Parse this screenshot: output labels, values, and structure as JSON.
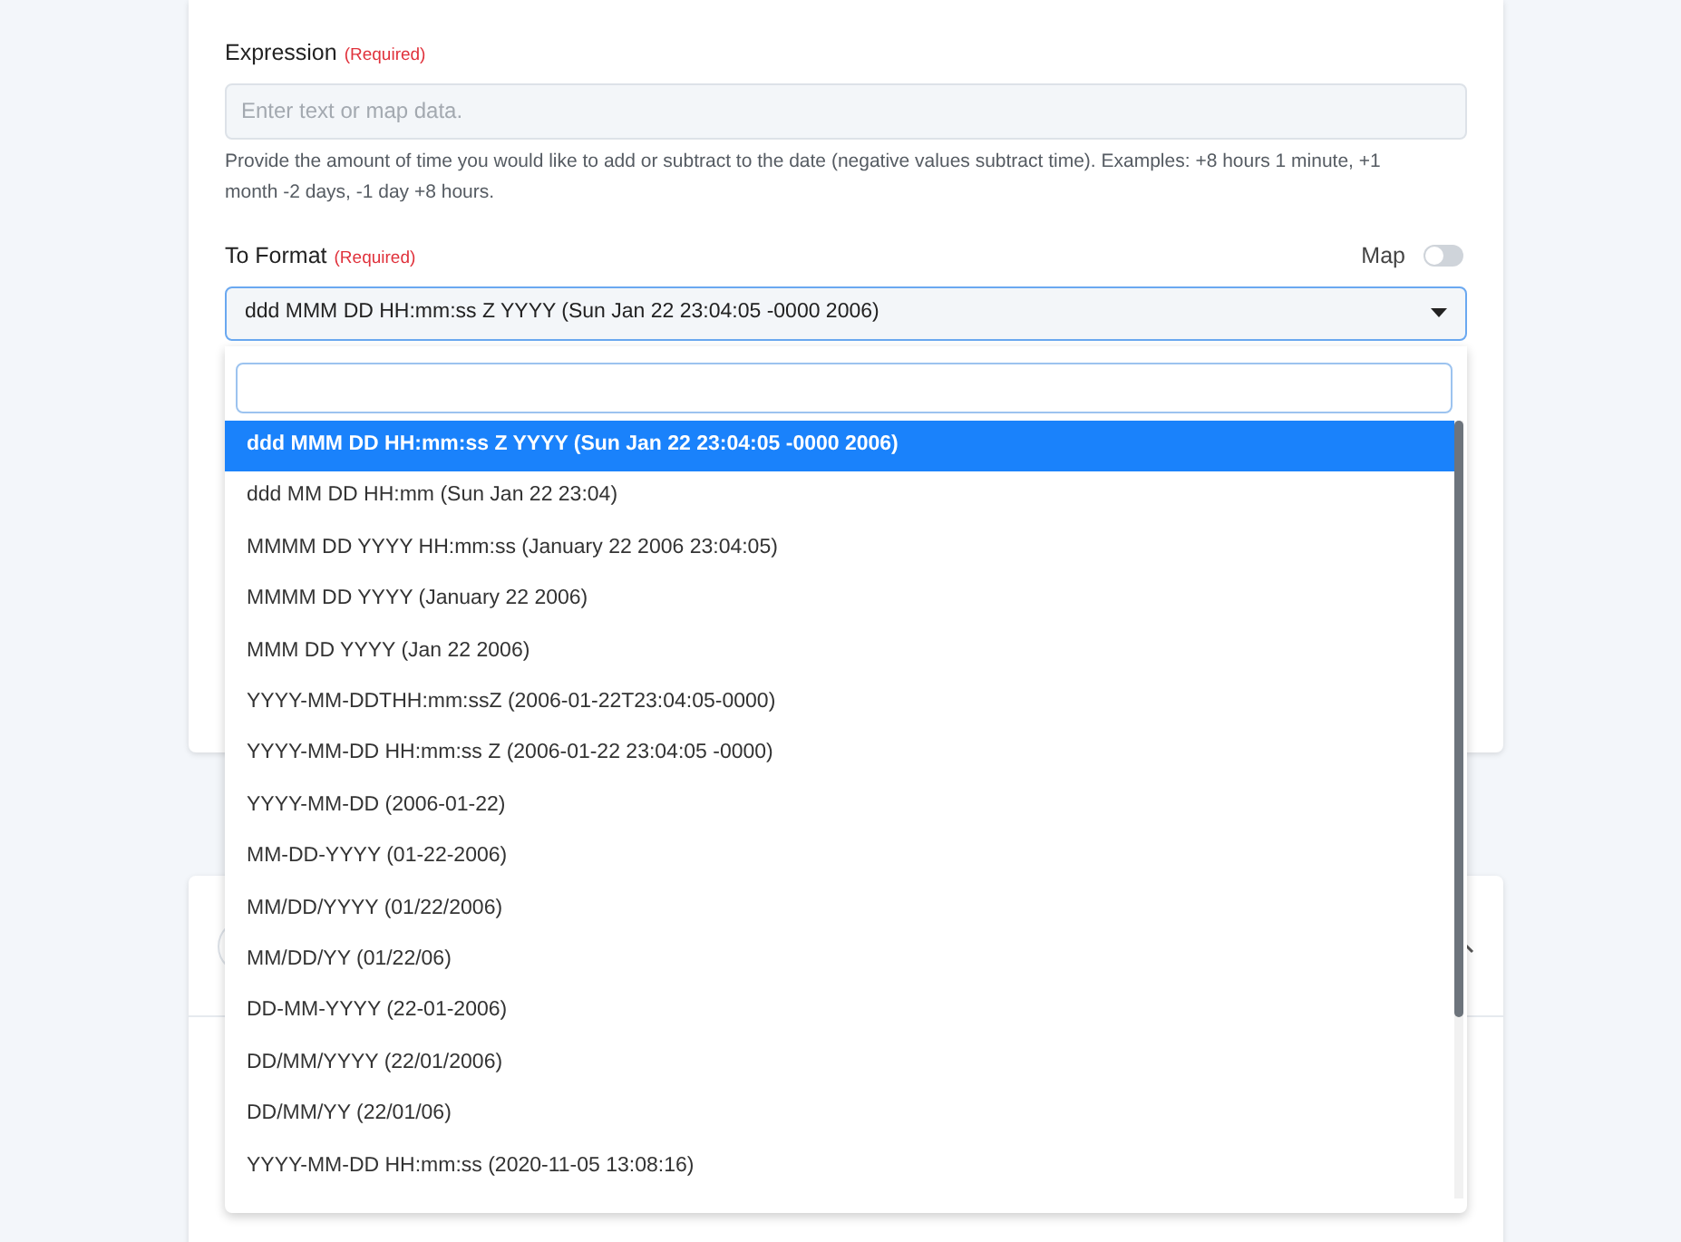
{
  "expression": {
    "label": "Expression",
    "required": "(Required)",
    "placeholder": "Enter text or map data.",
    "help": "Provide the amount of time you would like to add or subtract to the date (negative values subtract time). Examples: +8 hours 1 minute, +1 month -2 days, -1 day +8 hours."
  },
  "to_format": {
    "label": "To Format",
    "required": "(Required)",
    "map_label": "Map",
    "map_on": false,
    "value": "ddd MMM DD HH:mm:ss Z YYYY (Sun Jan 22 23:04:05 -0000 2006)",
    "expanded": true
  },
  "options": [
    {
      "label": "ddd MMM DD HH:mm:ss Z YYYY (Sun Jan 22 23:04:05 -0000 2006)",
      "selected": true
    },
    {
      "label": "ddd MM DD HH:mm (Sun Jan 22 23:04)",
      "selected": false
    },
    {
      "label": "MMMM DD YYYY HH:mm:ss (January 22 2006 23:04:05)",
      "selected": false
    },
    {
      "label": "MMMM DD YYYY (January 22 2006)",
      "selected": false
    },
    {
      "label": "MMM DD YYYY (Jan 22 2006)",
      "selected": false
    },
    {
      "label": "YYYY-MM-DDTHH:mm:ssZ (2006-01-22T23:04:05-0000)",
      "selected": false
    },
    {
      "label": "YYYY-MM-DD HH:mm:ss Z (2006-01-22 23:04:05 -0000)",
      "selected": false
    },
    {
      "label": "YYYY-MM-DD (2006-01-22)",
      "selected": false
    },
    {
      "label": "MM-DD-YYYY (01-22-2006)",
      "selected": false
    },
    {
      "label": "MM/DD/YYYY (01/22/2006)",
      "selected": false
    },
    {
      "label": "MM/DD/YY (01/22/06)",
      "selected": false
    },
    {
      "label": "DD-MM-YYYY (22-01-2006)",
      "selected": false
    },
    {
      "label": "DD/MM/YYYY (22/01/2006)",
      "selected": false
    },
    {
      "label": "DD/MM/YY (22/01/06)",
      "selected": false
    },
    {
      "label": "YYYY-MM-DD HH:mm:ss (2020-11-05 13:08:16)",
      "selected": false
    }
  ]
}
